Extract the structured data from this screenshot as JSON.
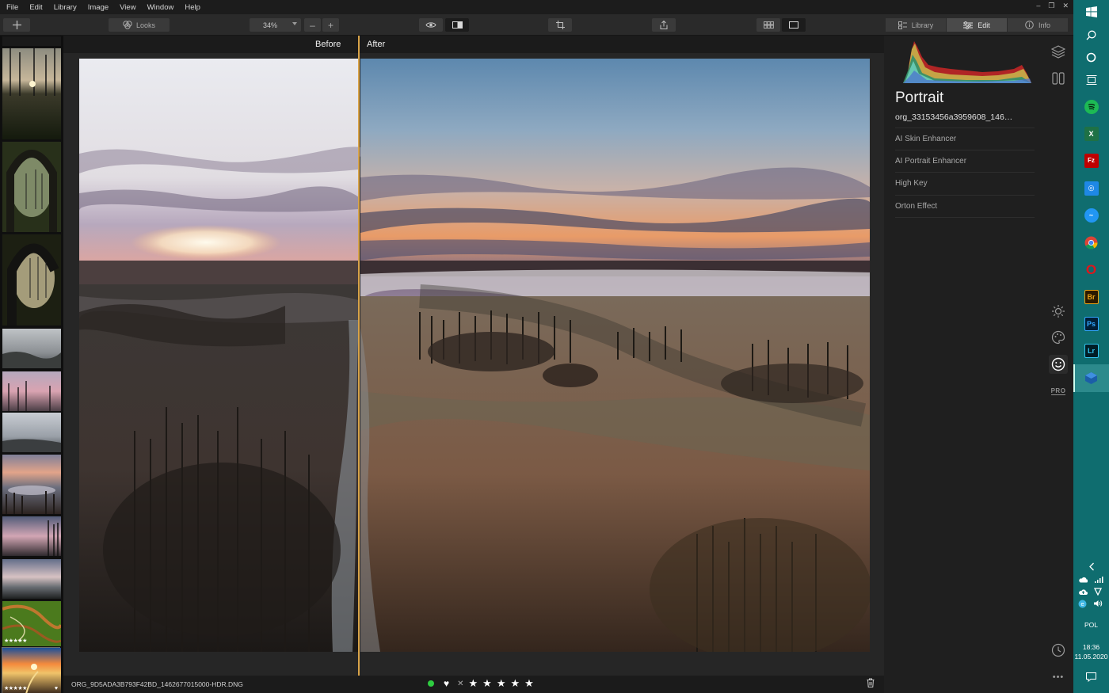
{
  "menu": [
    "File",
    "Edit",
    "Library",
    "Image",
    "View",
    "Window",
    "Help"
  ],
  "window_controls": {
    "minimize": "–",
    "restore": "❐",
    "close": "✕"
  },
  "toolbar": {
    "looks_label": "Looks",
    "zoom_value": "34%",
    "zoom_out": "–",
    "zoom_in": "+"
  },
  "right_tabs": [
    {
      "label": "Library",
      "icon": "library-icon"
    },
    {
      "label": "Edit",
      "icon": "sliders-icon",
      "active": true
    },
    {
      "label": "Info",
      "icon": "info-icon"
    }
  ],
  "compare": {
    "before_label": "Before",
    "after_label": "After"
  },
  "filmstrip": {
    "thumbs": [
      {
        "stars": "",
        "heart": ""
      },
      {
        "stars": "",
        "heart": ""
      },
      {
        "stars": "",
        "heart": ""
      },
      {
        "stars": "",
        "heart": ""
      },
      {
        "stars": "",
        "heart": ""
      },
      {
        "stars": "",
        "heart": ""
      },
      {
        "stars": "",
        "heart": ""
      },
      {
        "stars": "",
        "heart": ""
      },
      {
        "stars": "",
        "heart": ""
      },
      {
        "stars": "★★★★★",
        "heart": ""
      },
      {
        "stars": "★★★★★",
        "heart": "♥"
      }
    ]
  },
  "status": {
    "filename": "ORG_9D5ADA3B793F42BD_1462677015000-HDR.DNG",
    "color_label": "#2ecc40",
    "rating": 5,
    "stars": [
      "★",
      "★",
      "★",
      "★",
      "★"
    ],
    "reject_label": "✕",
    "heart_label": "♥"
  },
  "panel": {
    "title": "Portrait",
    "preset_name": "org_33153456a3959608_146…",
    "presets": [
      "AI Skin Enhancer",
      "AI Portrait Enhancer",
      "High Key",
      "Orton Effect"
    ],
    "side_icons": [
      "layers-icon",
      "compare-panels-icon",
      "sun-icon",
      "palette-icon",
      "smiley-icon",
      "pro-icon",
      "history-icon",
      "more-icon"
    ],
    "pro_label": "PRO",
    "more_label": "•••"
  },
  "taskbar": {
    "apps": [
      {
        "name": "spotify",
        "letter": "",
        "color": "#1db954"
      },
      {
        "name": "excel",
        "letter": "X",
        "color": "#1e7145"
      },
      {
        "name": "filezilla",
        "letter": "Fz",
        "color": "#bf0000"
      },
      {
        "name": "app-blue",
        "letter": "◎",
        "color": "#1e88e5"
      },
      {
        "name": "messenger",
        "letter": "~",
        "color": "#2196f3"
      },
      {
        "name": "chrome",
        "letter": "",
        "color": "#e8e8e8"
      },
      {
        "name": "opera",
        "letter": "O",
        "color": "#e0151b"
      },
      {
        "name": "bridge",
        "letter": "Br",
        "color": "#2b1a00"
      },
      {
        "name": "photoshop",
        "letter": "Ps",
        "color": "#001e36"
      },
      {
        "name": "lightroom",
        "letter": "Lr",
        "color": "#001d26"
      },
      {
        "name": "luminar",
        "letter": "◆",
        "color": "#1b5ea8"
      }
    ],
    "lang": "POL",
    "time": "18:36",
    "date": "11.05.2020"
  }
}
